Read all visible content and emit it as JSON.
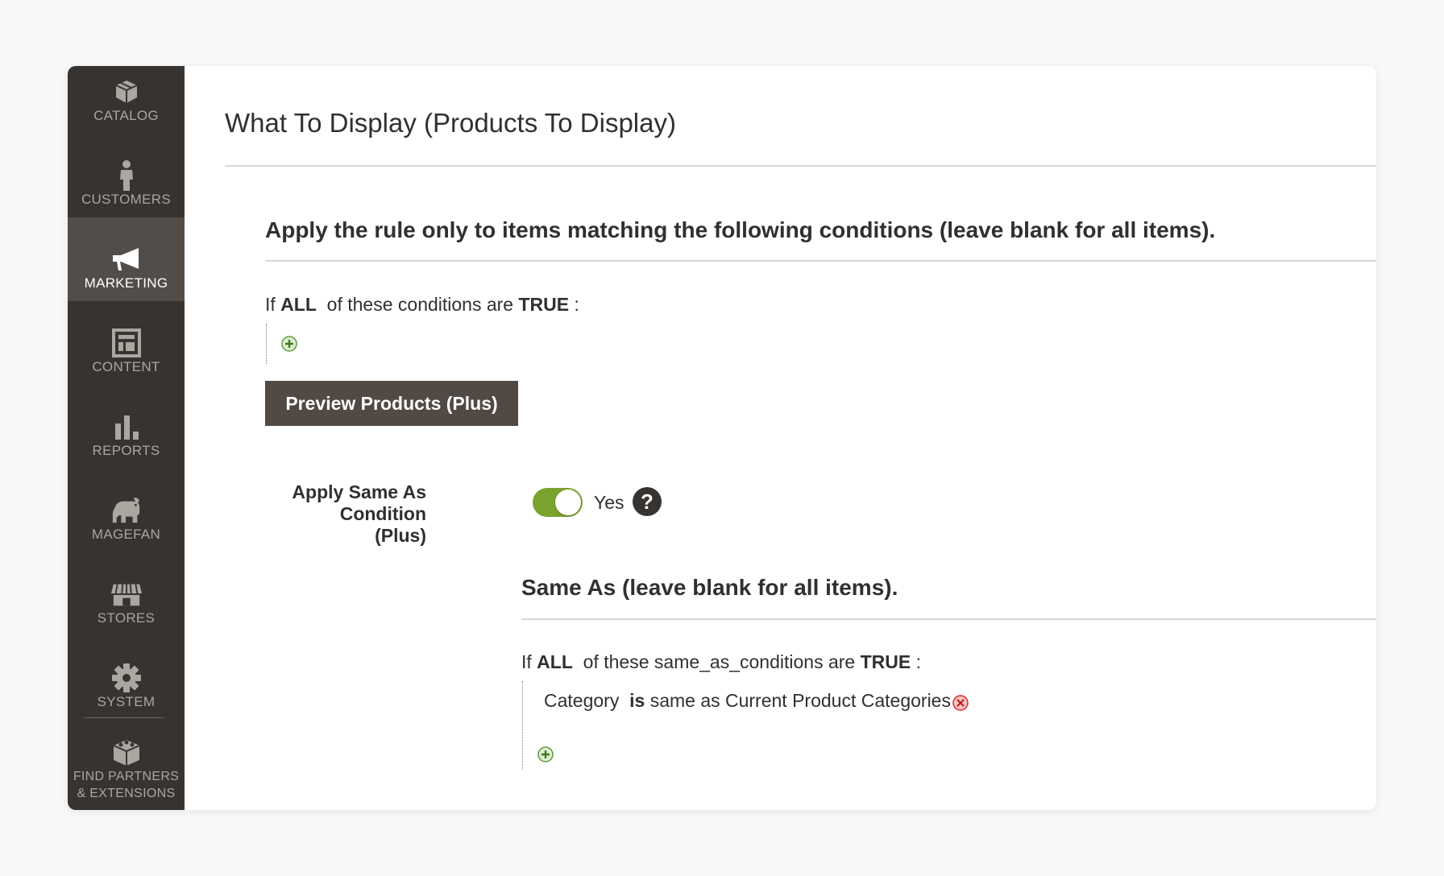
{
  "sidebar": {
    "items": [
      {
        "label": "CATALOG",
        "icon": "box-icon"
      },
      {
        "label": "CUSTOMERS",
        "icon": "person-icon"
      },
      {
        "label": "MARKETING",
        "icon": "megaphone-icon",
        "active": true
      },
      {
        "label": "CONTENT",
        "icon": "layout-icon"
      },
      {
        "label": "REPORTS",
        "icon": "bar-chart-icon"
      },
      {
        "label": "MAGEFAN",
        "icon": "elephant-icon"
      },
      {
        "label": "STORES",
        "icon": "storefront-icon"
      },
      {
        "label": "SYSTEM",
        "icon": "gear-icon"
      }
    ],
    "partners": {
      "line1": "FIND PARTNERS",
      "line2": "& EXTENSIONS",
      "icon": "blocks-icon"
    }
  },
  "main": {
    "title": "What To Display (Products To Display)",
    "conditions": {
      "heading": "Apply the rule only to items matching the following conditions (leave blank for all items).",
      "prefix": "If",
      "aggregator": "ALL",
      "middle": "of these conditions are",
      "value": "TRUE",
      "suffix": ":"
    },
    "preview_button": "Preview Products (Plus)",
    "same_as_toggle": {
      "label_line1": "Apply Same As Condition",
      "label_line2": "(Plus)",
      "state_label": "Yes",
      "help": "?"
    },
    "same_as": {
      "heading": "Same As (leave blank for all items).",
      "prefix": "If",
      "aggregator": "ALL",
      "middle": "of these same_as_conditions are",
      "value": "TRUE",
      "suffix": ":",
      "condition": {
        "attribute": "Category",
        "operator": "is",
        "value": "same as Current Product Categories"
      }
    }
  },
  "colors": {
    "sidebar_bg": "#373330",
    "sidebar_active": "#524d49",
    "button_bg": "#514943",
    "toggle_on": "#79a22e",
    "add_green": "#5f9b3b",
    "remove_red": "#e22626"
  }
}
